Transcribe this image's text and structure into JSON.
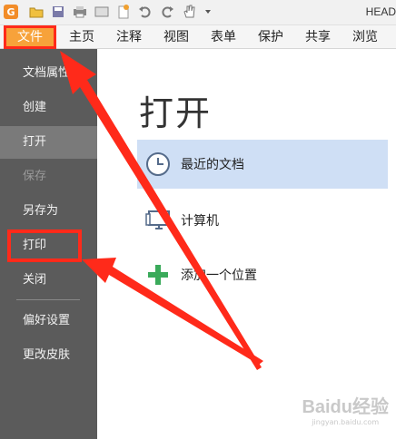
{
  "window": {
    "title": "HEAD"
  },
  "ribbon": {
    "tabs": [
      {
        "label": "文件"
      },
      {
        "label": "主页"
      },
      {
        "label": "注释"
      },
      {
        "label": "视图"
      },
      {
        "label": "表单"
      },
      {
        "label": "保护"
      },
      {
        "label": "共享"
      },
      {
        "label": "浏览"
      }
    ]
  },
  "sidebar": {
    "items": [
      {
        "label": "文档属性"
      },
      {
        "label": "创建"
      },
      {
        "label": "打开"
      },
      {
        "label": "保存"
      },
      {
        "label": "另存为"
      },
      {
        "label": "打印"
      },
      {
        "label": "关闭"
      },
      {
        "label": "偏好设置"
      },
      {
        "label": "更改皮肤"
      }
    ]
  },
  "main": {
    "title": "打开",
    "places": [
      {
        "label": "最近的文档",
        "icon": "clock-icon"
      },
      {
        "label": "计算机",
        "icon": "computer-icon"
      },
      {
        "label": "添加一个位置",
        "icon": "plus-icon"
      }
    ]
  },
  "watermark": {
    "text": "Baidu经验",
    "sub": "jingyan.baidu.com"
  },
  "colors": {
    "accent": "#f7a23a",
    "annotation": "#ff2a1a",
    "sidebar_bg": "#5b5b5b",
    "selected_bg": "#cfdff5",
    "plus_icon": "#3aaa5a"
  }
}
